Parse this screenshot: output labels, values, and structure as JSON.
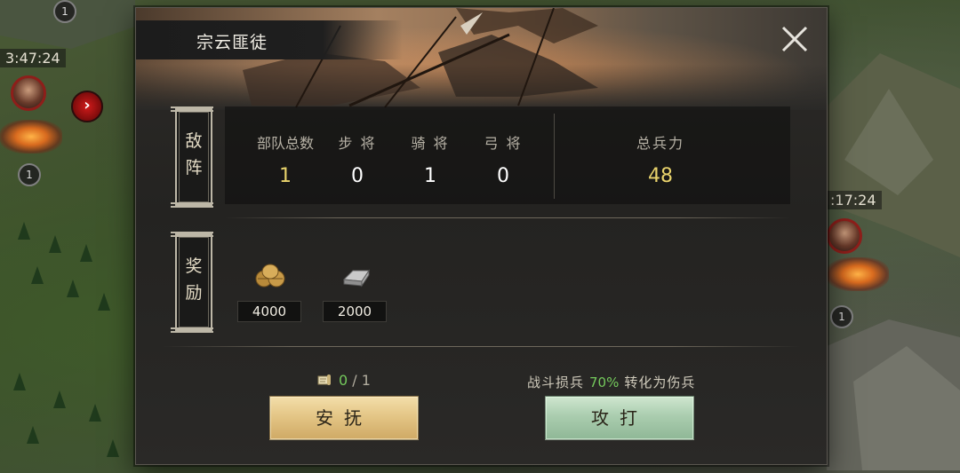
{
  "map": {
    "timers": [
      "3:47:24",
      ":17:24"
    ],
    "levels": [
      "1",
      "1",
      "1"
    ]
  },
  "dialog": {
    "title": "宗云匪徒",
    "enemy_section": {
      "plaque_chars": [
        "敌",
        "阵"
      ],
      "stats": [
        {
          "label": "部队总数",
          "value": "1",
          "highlight": true
        },
        {
          "label": "步 将",
          "value": "0",
          "highlight": false
        },
        {
          "label": "骑 将",
          "value": "1",
          "highlight": false
        },
        {
          "label": "弓 将",
          "value": "0",
          "highlight": false
        }
      ],
      "total": {
        "label": "总兵力",
        "value": "48"
      }
    },
    "reward_section": {
      "plaque_chars": [
        "奖",
        "励"
      ],
      "rewards": [
        {
          "icon": "grain-icon",
          "value": "4000"
        },
        {
          "icon": "iron-ingot-icon",
          "value": "2000"
        }
      ]
    },
    "token": {
      "current": "0",
      "separator": " / ",
      "max": "1",
      "icon": "scroll-token-icon"
    },
    "conversion_note": {
      "prefix": "战斗损兵",
      "percent": "70%",
      "suffix": "转化为伤兵"
    },
    "buttons": {
      "pacify": "安抚",
      "attack": "攻打"
    }
  },
  "colors": {
    "gold_value": "#e9d36c",
    "green_value": "#74c95c",
    "pacify_button": "#e4c686",
    "attack_button": "#aacdaf",
    "map_marker": "#d11a1a"
  }
}
